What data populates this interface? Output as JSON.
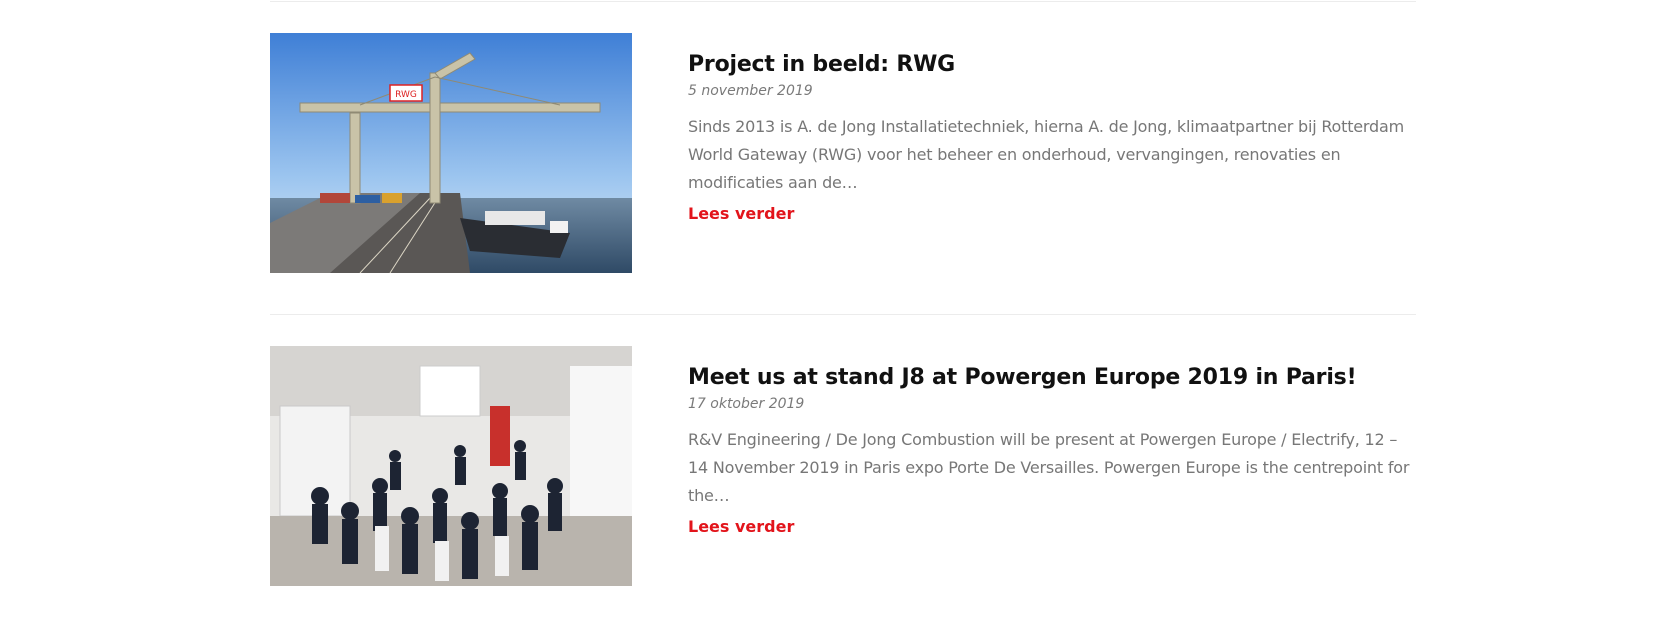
{
  "posts": [
    {
      "title": "Project in beeld: RWG",
      "date": "5 november 2019",
      "excerpt": "Sinds 2013 is A. de Jong Installatietechniek, hierna A. de Jong, klimaatpartner bij Rotterdam World Gateway (RWG) voor het beheer en onderhoud, vervangingen, renovaties en modificaties aan de…",
      "read_more": "Lees verder",
      "image_sign": "RWG"
    },
    {
      "title": "Meet us at stand J8 at Powergen Europe 2019 in Paris!",
      "date": "17 oktober 2019",
      "excerpt": "R&V Engineering / De Jong Combustion will be present at Powergen Europe / Electrify, 12 – 14 November 2019 in Paris expo Porte De Versailles. Powergen Europe is the centrepoint for the…",
      "read_more": "Lees verder"
    }
  ],
  "colors": {
    "accent": "#e2141b",
    "title": "#111111",
    "text": "#777777",
    "divider": "#ececec"
  }
}
